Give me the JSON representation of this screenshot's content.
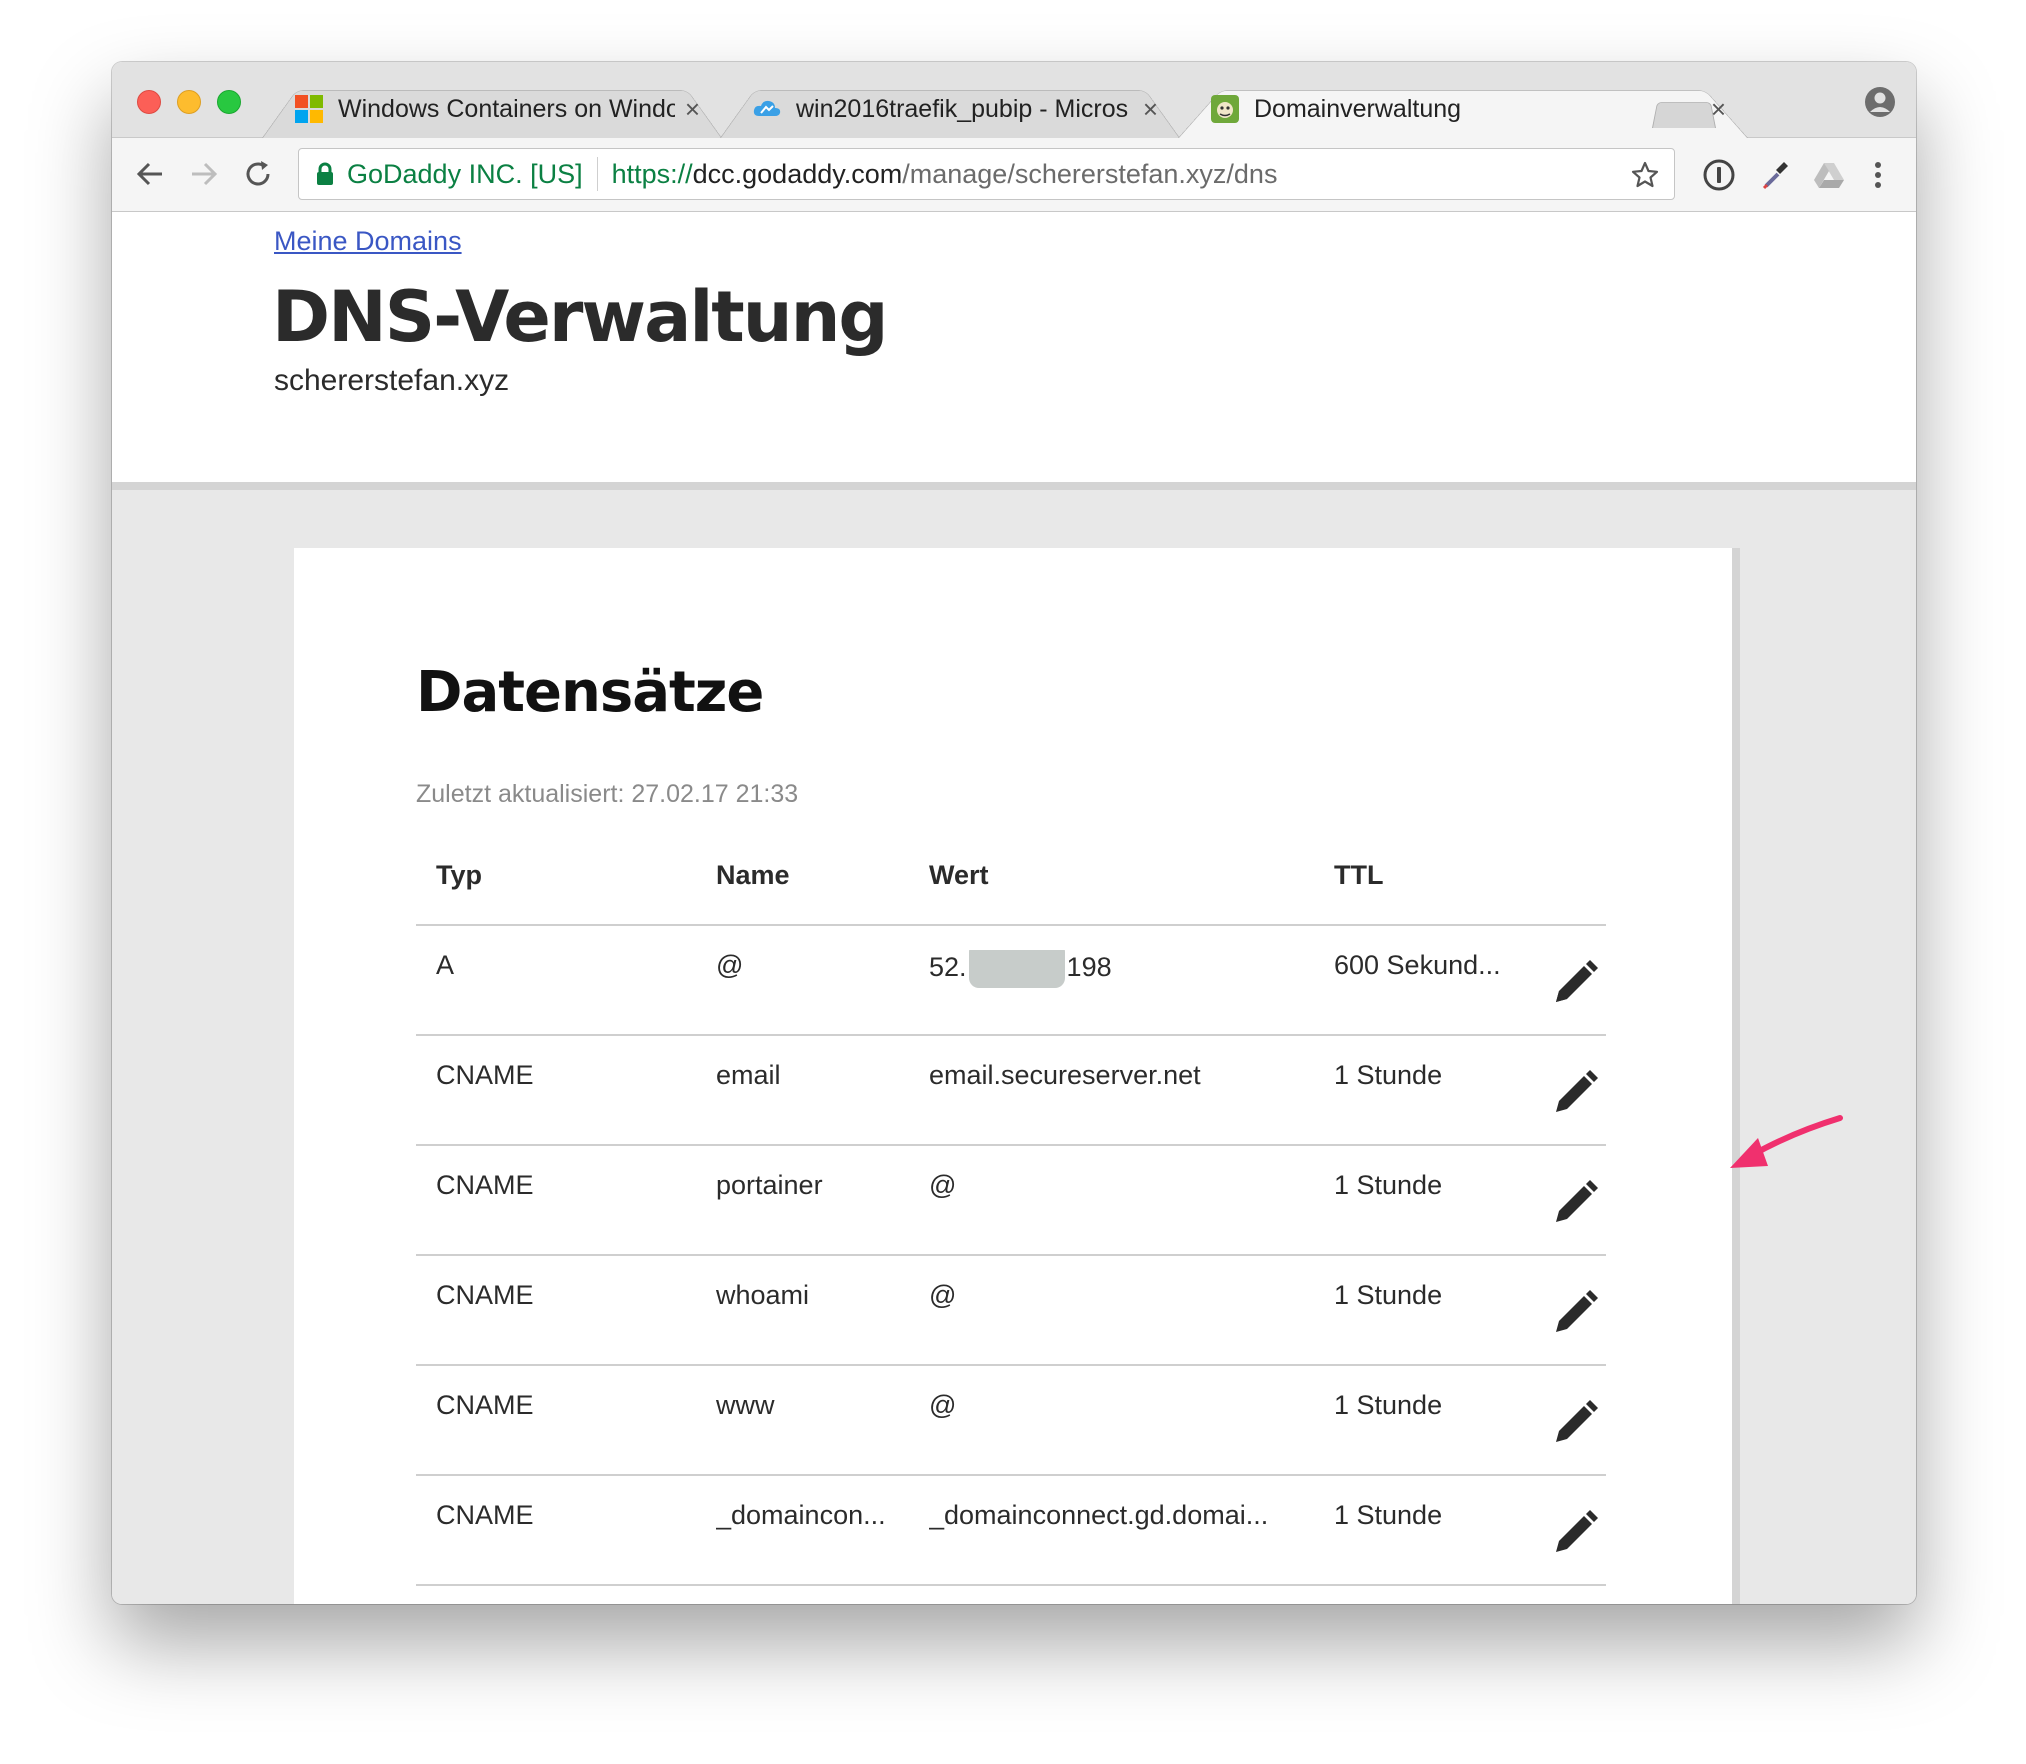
{
  "browser": {
    "tabs": [
      {
        "title": "Windows Containers on Windo",
        "close": "×"
      },
      {
        "title": "win2016traefik_pubip - Micros",
        "close": "×"
      },
      {
        "title": "Domainverwaltung",
        "close": "×"
      }
    ],
    "omnibox": {
      "org": "GoDaddy INC. [US]",
      "scheme": "https://",
      "host": "dcc.godaddy.com",
      "path": "/manage/schererstefan.xyz/dns"
    }
  },
  "page": {
    "breadcrumb": "Meine Domains",
    "title": "DNS-Verwaltung",
    "domain": "schererstefan.xyz",
    "records": {
      "title": "Datensätze",
      "last_updated": "Zuletzt aktualisiert: 27.02.17 21:33",
      "columns": [
        "Typ",
        "Name",
        "Wert",
        "TTL"
      ],
      "rows": [
        {
          "type": "A",
          "name": "@",
          "value_prefix": "52.",
          "value_suffix": "198",
          "ttl": "600 Sekund..."
        },
        {
          "type": "CNAME",
          "name": "email",
          "value": "email.secureserver.net",
          "ttl": "1 Stunde"
        },
        {
          "type": "CNAME",
          "name": "portainer",
          "value": "@",
          "ttl": "1 Stunde"
        },
        {
          "type": "CNAME",
          "name": "whoami",
          "value": "@",
          "ttl": "1 Stunde"
        },
        {
          "type": "CNAME",
          "name": "www",
          "value": "@",
          "ttl": "1 Stunde"
        },
        {
          "type": "CNAME",
          "name": "_domaincon...",
          "value": "_domainconnect.gd.domai...",
          "ttl": "1 Stunde"
        }
      ]
    }
  },
  "colors": {
    "accent_link": "#3a57c4",
    "secure_green": "#0b8043",
    "annotation_arrow": "#f0306e"
  },
  "icons": [
    "windows-logo-icon",
    "azure-cloud-icon",
    "godaddy-favicon-icon",
    "profile-icon",
    "back-icon",
    "forward-icon",
    "reload-icon",
    "lock-icon",
    "star-icon",
    "password-manager-icon",
    "eyedropper-icon",
    "drive-icon",
    "menu-icon",
    "pencil-icon"
  ]
}
